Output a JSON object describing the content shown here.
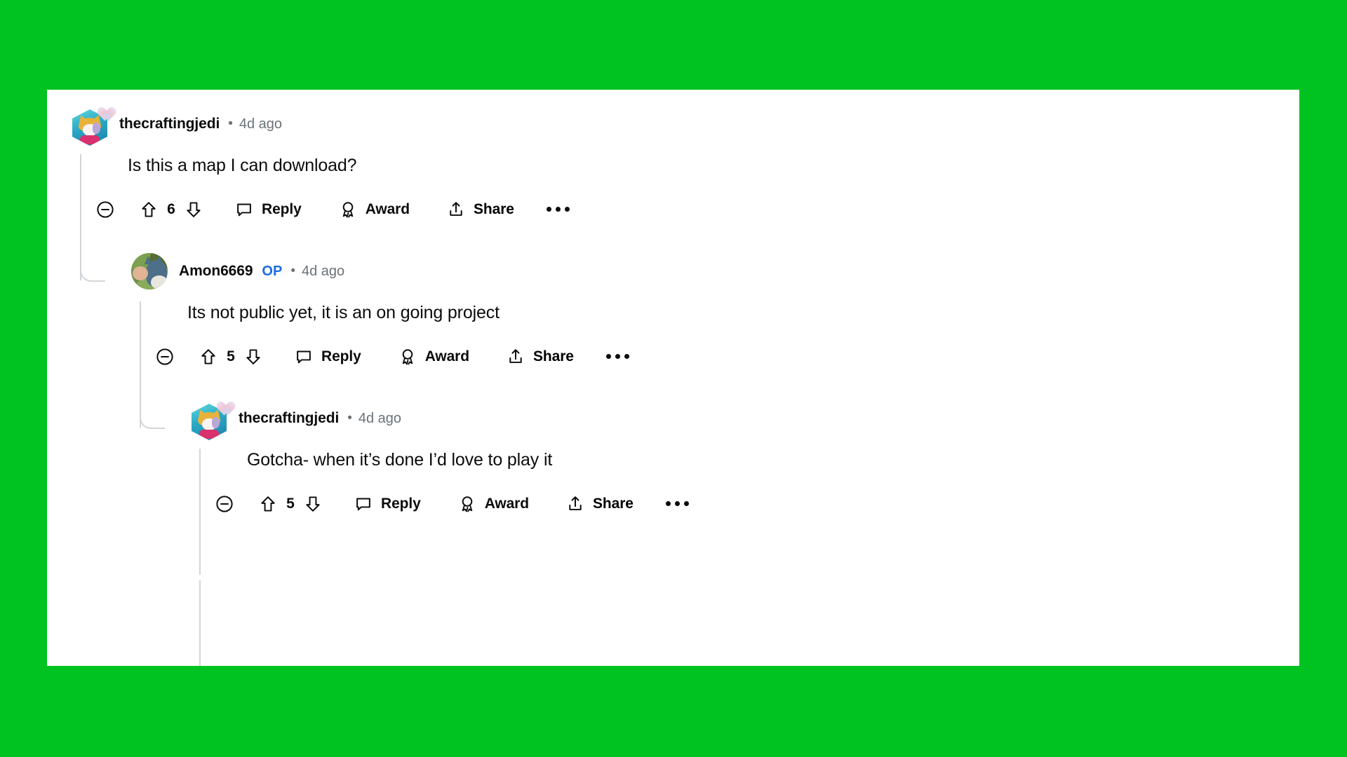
{
  "page": {
    "background_color": "#00c220",
    "card_background": "#ffffff"
  },
  "theme": {
    "text_primary": "#0b0c0d",
    "text_muted": "#6a7278",
    "op_badge_color": "#1c6ce0",
    "thread_line_color": "#d2d5d8"
  },
  "thread": {
    "comments": [
      {
        "id": "comment-1",
        "username": "thecraftingjedi",
        "is_op": false,
        "op_label": "",
        "separator": "•",
        "timestamp": "4d ago",
        "body": "Is this a map I can download?",
        "vote_count": "6",
        "avatar_type": "hexagon-snoo",
        "actions": {
          "collapse_label": "",
          "upvote_label": "",
          "downvote_label": "",
          "reply_label": "Reply",
          "award_label": "Award",
          "share_label": "Share",
          "more_label": ""
        }
      },
      {
        "id": "comment-2",
        "username": "Amon6669",
        "is_op": true,
        "op_label": "OP",
        "separator": "•",
        "timestamp": "4d ago",
        "body": "Its not public yet, it is an on going project",
        "vote_count": "5",
        "avatar_type": "round-photo",
        "actions": {
          "collapse_label": "",
          "upvote_label": "",
          "downvote_label": "",
          "reply_label": "Reply",
          "award_label": "Award",
          "share_label": "Share",
          "more_label": ""
        }
      },
      {
        "id": "comment-3",
        "username": "thecraftingjedi",
        "is_op": false,
        "op_label": "",
        "separator": "•",
        "timestamp": "4d ago",
        "body": "Gotcha- when it’s done I’d love to play it",
        "vote_count": "5",
        "avatar_type": "hexagon-snoo",
        "actions": {
          "collapse_label": "",
          "upvote_label": "",
          "downvote_label": "",
          "reply_label": "Reply",
          "award_label": "Award",
          "share_label": "Share",
          "more_label": ""
        }
      }
    ]
  },
  "icons": {
    "collapse": "collapse-icon",
    "upvote": "upvote-icon",
    "downvote": "downvote-icon",
    "reply": "comment-bubble-icon",
    "award": "award-ribbon-icon",
    "share": "share-arrow-icon",
    "more": "overflow-menu-icon"
  }
}
